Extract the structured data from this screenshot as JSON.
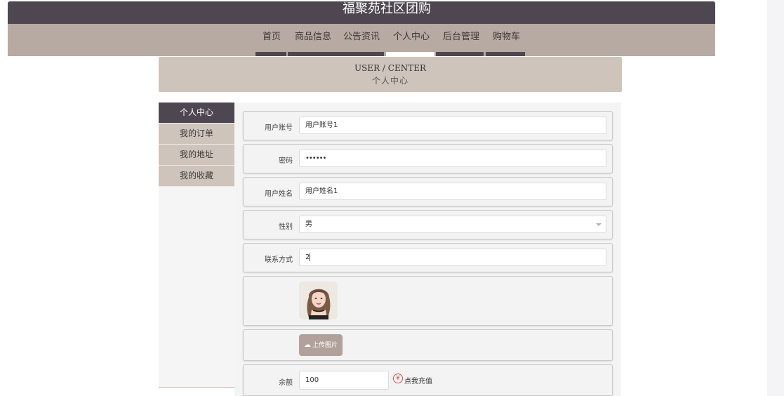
{
  "site": {
    "title": "福聚苑社区团购"
  },
  "nav": {
    "items": [
      {
        "label": "首页"
      },
      {
        "label": "商品信息"
      },
      {
        "label": "公告资讯"
      },
      {
        "label": "个人中心"
      },
      {
        "label": "后台管理"
      },
      {
        "label": "购物车"
      }
    ],
    "active": "个人中心"
  },
  "banner": {
    "en": "USER / CENTER",
    "cn": "个人中心"
  },
  "side_menu": {
    "items": [
      {
        "label": "个人中心"
      },
      {
        "label": "我的订单"
      },
      {
        "label": "我的地址"
      },
      {
        "label": "我的收藏"
      }
    ],
    "active": "个人中心"
  },
  "form": {
    "account": {
      "label": "用户账号",
      "value": "用户账号1"
    },
    "password": {
      "label": "密码",
      "value": "••••••"
    },
    "name": {
      "label": "用户姓名",
      "value": "用户姓名1"
    },
    "gender": {
      "label": "性别",
      "value": "男"
    },
    "contact": {
      "label": "联系方式",
      "value": "2"
    },
    "upload": {
      "label": "上传图片",
      "icon": "cloud-upload-icon"
    },
    "balance": {
      "label": "余额",
      "value": "100",
      "recharge": "点我充值",
      "icon": "yen-icon"
    }
  },
  "colors": {
    "top_bar": "#4e4752",
    "nav_bar": "#b7aaa2",
    "banner": "#cfc4bb",
    "accent_red": "#e04c4c"
  }
}
